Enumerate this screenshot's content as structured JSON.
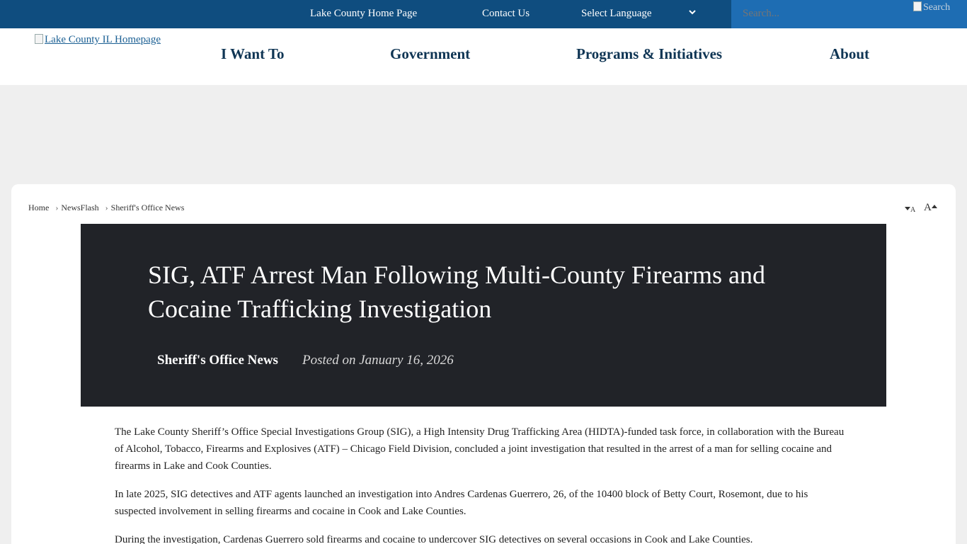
{
  "topbar": {
    "home_link": "Lake County Home Page",
    "contact_link": "Contact Us",
    "language": "Select Language",
    "search_placeholder": "Search...",
    "search_button_alt": "Search"
  },
  "header": {
    "logo_alt": "Lake County IL Homepage",
    "nav": [
      "I Want To",
      "Government",
      "Programs & Initiatives",
      "About"
    ]
  },
  "breadcrumb": [
    "Home",
    "NewsFlash",
    "Sheriff's Office News"
  ],
  "font_controls": {
    "decrease": "A",
    "increase": "A"
  },
  "article": {
    "title": "SIG, ATF Arrest Man Following Multi-County Firearms and Cocaine Trafficking Investigation",
    "category": "Sheriff's Office News",
    "posted": "Posted on January 16, 2026",
    "paragraphs": [
      "The Lake County Sheriff’s Office Special Investigations Group (SIG), a High Intensity Drug Trafficking Area (HIDTA)-funded task force, in collaboration with the Bureau of Alcohol, Tobacco, Firearms and Explosives (ATF) – Chicago Field Division, concluded a joint investigation that resulted in the arrest of a man for selling cocaine and firearms in Lake and Cook Counties.",
      "In late 2025, SIG detectives and ATF agents launched an investigation into Andres Cardenas Guerrero, 26, of the 10400 block of Betty Court, Rosemont, due to his suspected involvement in selling firearms and cocaine in Cook and Lake Counties.",
      "During the investigation, Cardenas Guerrero sold firearms and cocaine to undercover SIG detectives on several occasions in Cook and Lake Counties."
    ]
  },
  "colors": {
    "topbar": "#0f4d7f",
    "search_bg": "#1e6db3",
    "nav_text": "#0f3554",
    "hero_bg": "#212328",
    "page_bg": "#efefef"
  }
}
